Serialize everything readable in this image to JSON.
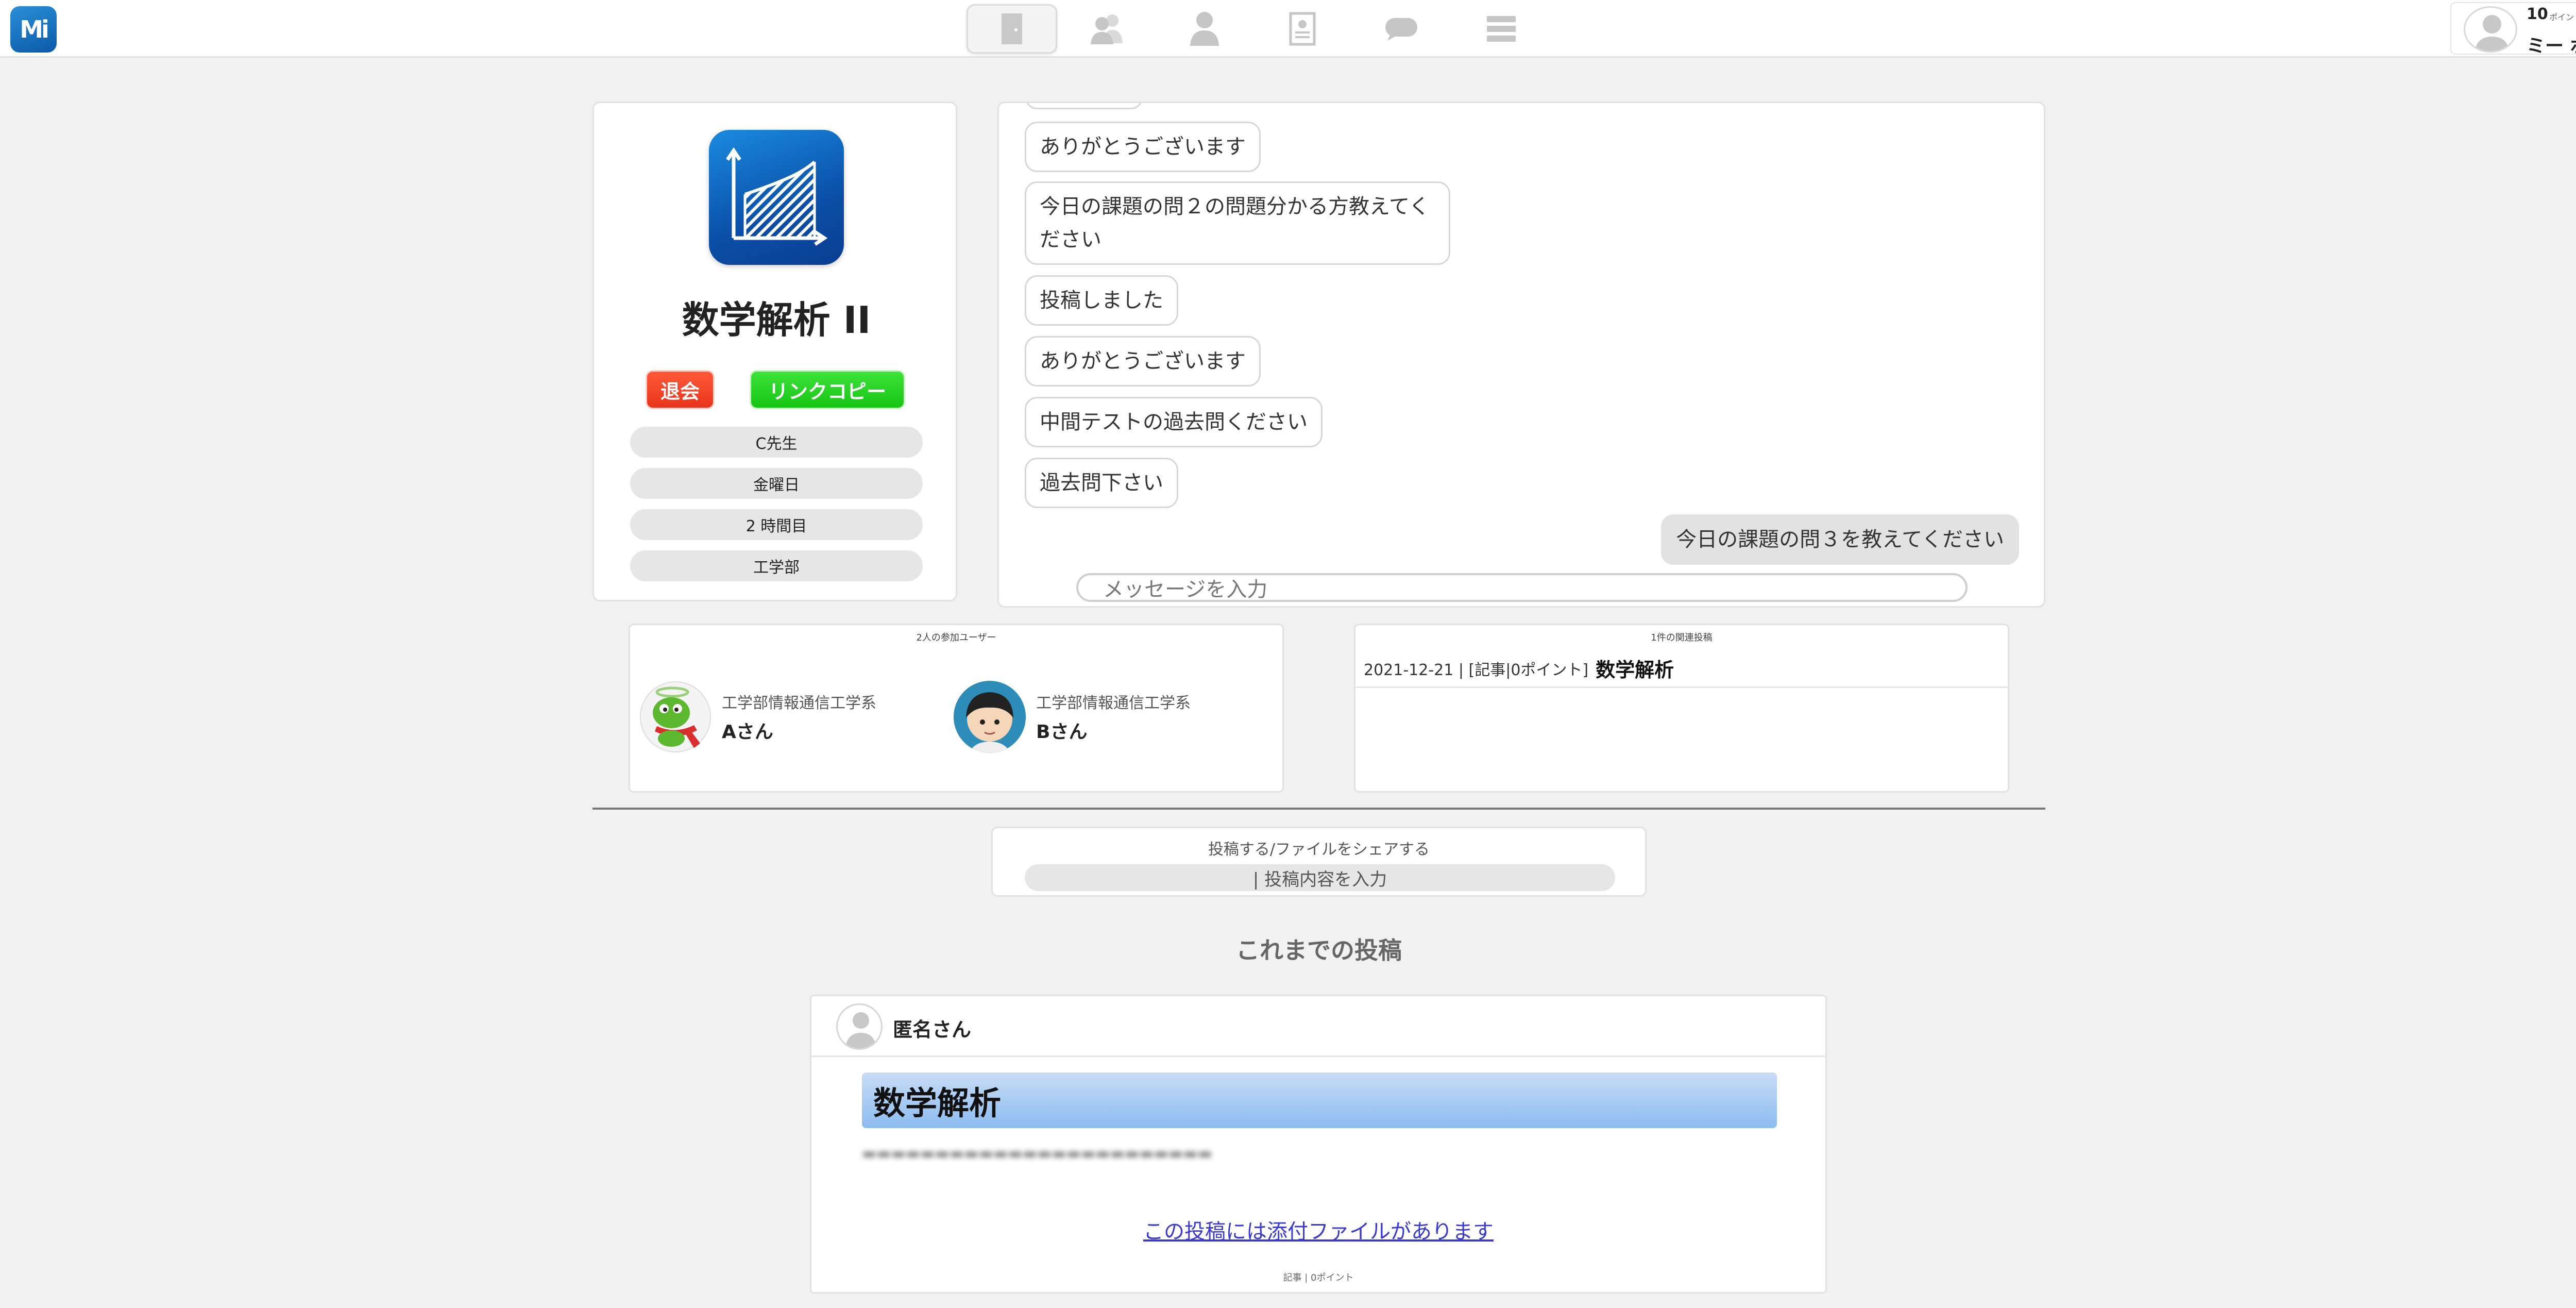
{
  "header": {
    "logo_text": "Mi",
    "nav": [
      {
        "icon": "door-icon",
        "active": true
      },
      {
        "icon": "users-icon",
        "active": false
      },
      {
        "icon": "person-icon",
        "active": false
      },
      {
        "icon": "profile-card-icon",
        "active": false
      },
      {
        "icon": "chat-bubble-icon",
        "active": false
      },
      {
        "icon": "menu-icon",
        "active": false
      }
    ],
    "user": {
      "points": "10",
      "points_label": "ポイント保有",
      "name": "ミー ボード"
    }
  },
  "course": {
    "title": "数学解析 II",
    "leave_label": "退会",
    "copy_link_label": "リンクコピー",
    "info": [
      "C先生",
      "金曜日",
      "2 時間目",
      "工学部"
    ]
  },
  "chat": {
    "messages": [
      {
        "text": "ありがとうございます",
        "mine": false
      },
      {
        "text": "今日の課題の問２の問題分かる方教えてください",
        "mine": false
      },
      {
        "text": "投稿しました",
        "mine": false
      },
      {
        "text": "ありがとうございます",
        "mine": false
      },
      {
        "text": "中間テストの過去問ください",
        "mine": false
      },
      {
        "text": "過去問下さい",
        "mine": false
      },
      {
        "text": "今日の課題の問３を教えてください",
        "mine": true
      }
    ],
    "input_placeholder": "メッセージを入力"
  },
  "participants": {
    "title": "2人の参加ユーザー",
    "users": [
      {
        "dept": "工学部情報通信工学系",
        "name": "Aさん"
      },
      {
        "dept": "工学部情報通信工学系",
        "name": "Bさん"
      }
    ]
  },
  "related": {
    "title": "1件の関連投稿",
    "items": [
      {
        "meta": "2021-12-21 | [記事|0ポイント]",
        "title": "数学解析"
      }
    ]
  },
  "compose": {
    "title": "投稿する/ファイルをシェアする",
    "placeholder": "| 投稿内容を入力"
  },
  "past_posts": {
    "title": "これまでの投稿",
    "post": {
      "author": "匿名さん",
      "title": "数学解析",
      "attachment_link": "この投稿には添付ファイルがあります",
      "meta": "記事 | 0ポイント"
    }
  }
}
